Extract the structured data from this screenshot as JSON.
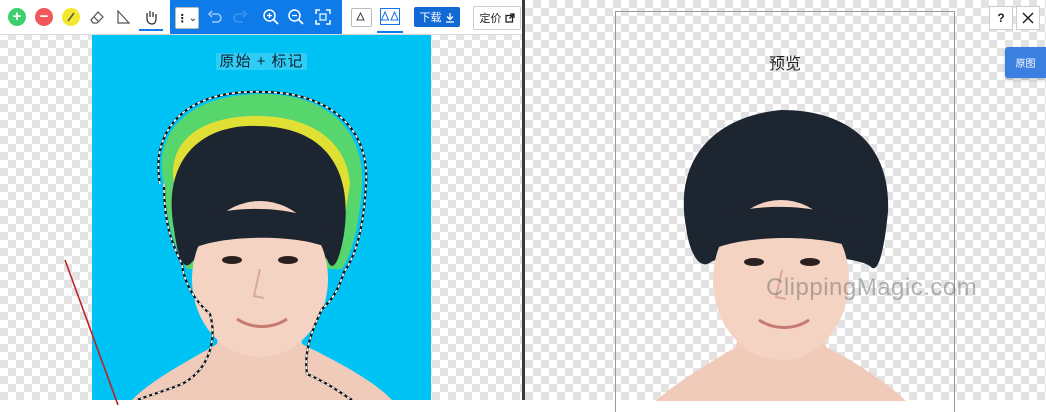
{
  "toolbar": {
    "download_label": "下载",
    "price_label": "定价",
    "dots_label": "⋮",
    "chevron_label": "⌄"
  },
  "original_pane": {
    "label": "原始 + 标记"
  },
  "preview_pane": {
    "label": "预览",
    "watermark": "ClippingMagic.com"
  },
  "right_controls": {
    "help_label": "?",
    "original_tab_label": "原图"
  },
  "colors": {
    "toolbar_blue": "#0e7be8",
    "add_green": "#3fcf6f",
    "remove_red": "#f0585b",
    "hair_yellow": "#f2e92f",
    "photo_bg": "#00c3f5",
    "download_blue": "#1169d3"
  }
}
